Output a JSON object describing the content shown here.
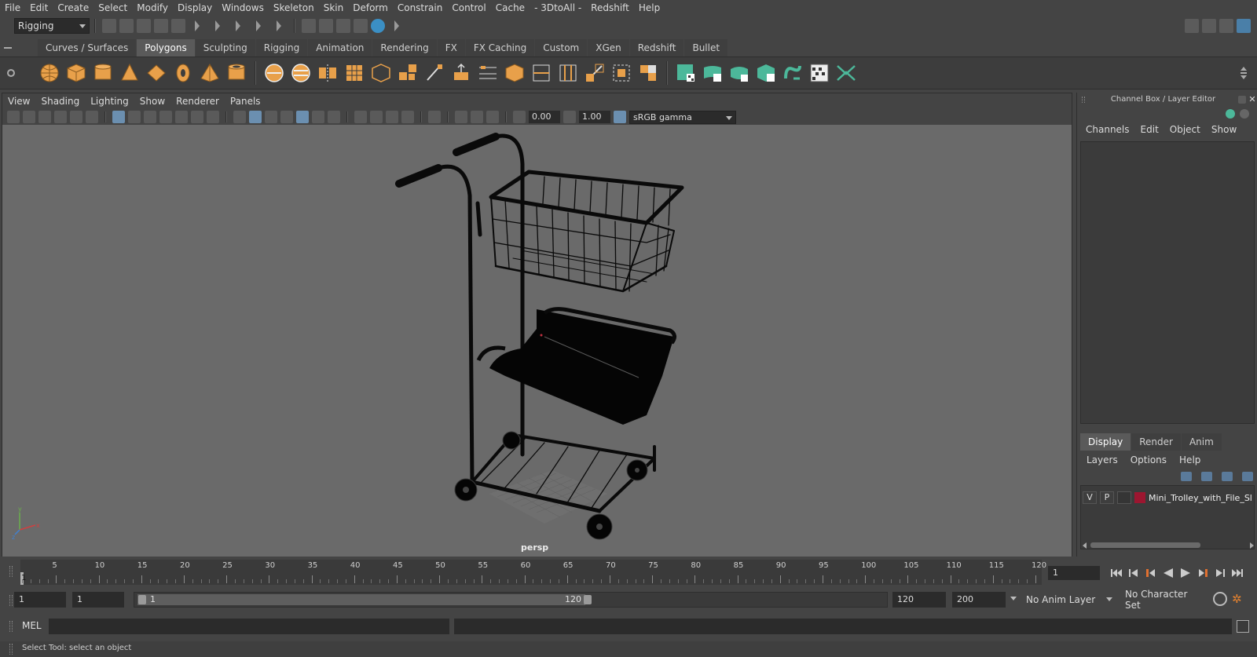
{
  "menubar": {
    "items": [
      "File",
      "Edit",
      "Create",
      "Select",
      "Modify",
      "Display",
      "Windows",
      "Skeleton",
      "Skin",
      "Deform",
      "Constrain",
      "Control",
      "Cache",
      "- 3DtoAll -",
      "Redshift",
      "Help"
    ]
  },
  "statusline": {
    "menuset": "Rigging"
  },
  "shelf": {
    "tabs": [
      "Curves / Surfaces",
      "Polygons",
      "Sculpting",
      "Rigging",
      "Animation",
      "Rendering",
      "FX",
      "FX Caching",
      "Custom",
      "XGen",
      "Redshift",
      "Bullet"
    ],
    "active_tab": "Polygons",
    "accent_orange": "#e8a04a",
    "accent_green": "#4cb89a"
  },
  "viewport": {
    "menu": [
      "View",
      "Shading",
      "Lighting",
      "Show",
      "Renderer",
      "Panels"
    ],
    "exposure": "0.00",
    "gamma": "1.00",
    "color_space": "sRGB gamma",
    "camera_label": "persp"
  },
  "channelbox": {
    "title": "Channel Box / Layer Editor",
    "menu": [
      "Channels",
      "Edit",
      "Object",
      "Show"
    ]
  },
  "layer_editor": {
    "tabs": [
      "Display",
      "Render",
      "Anim"
    ],
    "active_tab": "Display",
    "menu": [
      "Layers",
      "Options",
      "Help"
    ],
    "layer": {
      "visible": "V",
      "playback": "P",
      "color": "#9c1630",
      "name": "Mini_Trolley_with_File_Sl"
    }
  },
  "timeslider": {
    "start": 1,
    "end": 120,
    "labels": [
      "5",
      "10",
      "15",
      "20",
      "25",
      "30",
      "35",
      "40",
      "45",
      "50",
      "55",
      "60",
      "65",
      "70",
      "75",
      "80",
      "85",
      "90",
      "95",
      "100",
      "105",
      "110",
      "115",
      "120"
    ],
    "current_frame_marker": "1",
    "current_frame": "1"
  },
  "rangeslider": {
    "anim_start": "1",
    "playback_start": "1",
    "range_start_label": "1",
    "range_end_label": "120",
    "playback_end": "120",
    "anim_end": "200",
    "anim_layer": "No Anim Layer",
    "character_set": "No Character Set"
  },
  "cmdline": {
    "language": "MEL"
  },
  "helpline": {
    "text": "Select Tool: select an object"
  }
}
